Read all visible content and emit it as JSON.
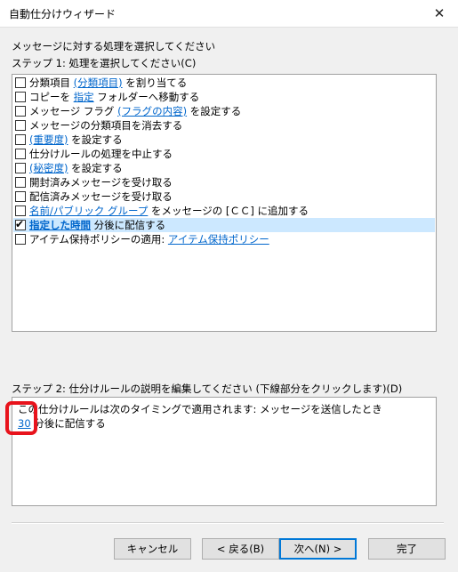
{
  "window": {
    "title": "自動仕分けウィザード",
    "close_glyph": "✕"
  },
  "prompt": "メッセージに対する処理を選択してください",
  "step1": {
    "label": "ステップ 1: 処理を選択してください(C)"
  },
  "actions": [
    {
      "checked": false,
      "parts": [
        {
          "text": "分類項目 "
        },
        {
          "text": "(分類項目)",
          "link": true
        },
        {
          "text": " を割り当てる"
        }
      ]
    },
    {
      "checked": false,
      "parts": [
        {
          "text": "コピーを "
        },
        {
          "text": "指定",
          "link": true
        },
        {
          "text": " フォルダーへ移動する"
        }
      ]
    },
    {
      "checked": false,
      "parts": [
        {
          "text": "メッセージ フラグ "
        },
        {
          "text": "(フラグの内容)",
          "link": true
        },
        {
          "text": " を設定する"
        }
      ]
    },
    {
      "checked": false,
      "parts": [
        {
          "text": "メッセージの分類項目を消去する"
        }
      ]
    },
    {
      "checked": false,
      "parts": [
        {
          "text": "(重要度)",
          "link": true
        },
        {
          "text": " を設定する"
        }
      ]
    },
    {
      "checked": false,
      "parts": [
        {
          "text": "仕分けルールの処理を中止する"
        }
      ]
    },
    {
      "checked": false,
      "parts": [
        {
          "text": "(秘密度)",
          "link": true
        },
        {
          "text": " を設定する"
        }
      ]
    },
    {
      "checked": false,
      "parts": [
        {
          "text": "開封済みメッセージを受け取る"
        }
      ]
    },
    {
      "checked": false,
      "parts": [
        {
          "text": "配信済みメッセージを受け取る"
        }
      ]
    },
    {
      "checked": false,
      "parts": [
        {
          "text": "名前/パブリック グループ",
          "link": true
        },
        {
          "text": " をメッセージの [ＣＣ] に追加する"
        }
      ]
    },
    {
      "checked": true,
      "selected": true,
      "parts": [
        {
          "text": "指定した時間",
          "link": true,
          "bold": true
        },
        {
          "text": " 分後に配信する"
        }
      ]
    },
    {
      "checked": false,
      "parts": [
        {
          "text": "アイテム保持ポリシーの適用: "
        },
        {
          "text": "アイテム保持ポリシー",
          "link": true
        }
      ]
    }
  ],
  "step2": {
    "label": "ステップ 2: 仕分けルールの説明を編集してください (下線部分をクリックします)(D)",
    "line1": "この仕分けルールは次のタイミングで適用されます: メッセージを送信したとき",
    "delay_value": "30",
    "line2_suffix": " 分後に配信する"
  },
  "buttons": {
    "cancel": "キャンセル",
    "back": "< 戻る(B)",
    "next": "次へ(N) >",
    "finish": "完了"
  },
  "accent_color": "#0078d7",
  "highlight_color": "#e8131c"
}
